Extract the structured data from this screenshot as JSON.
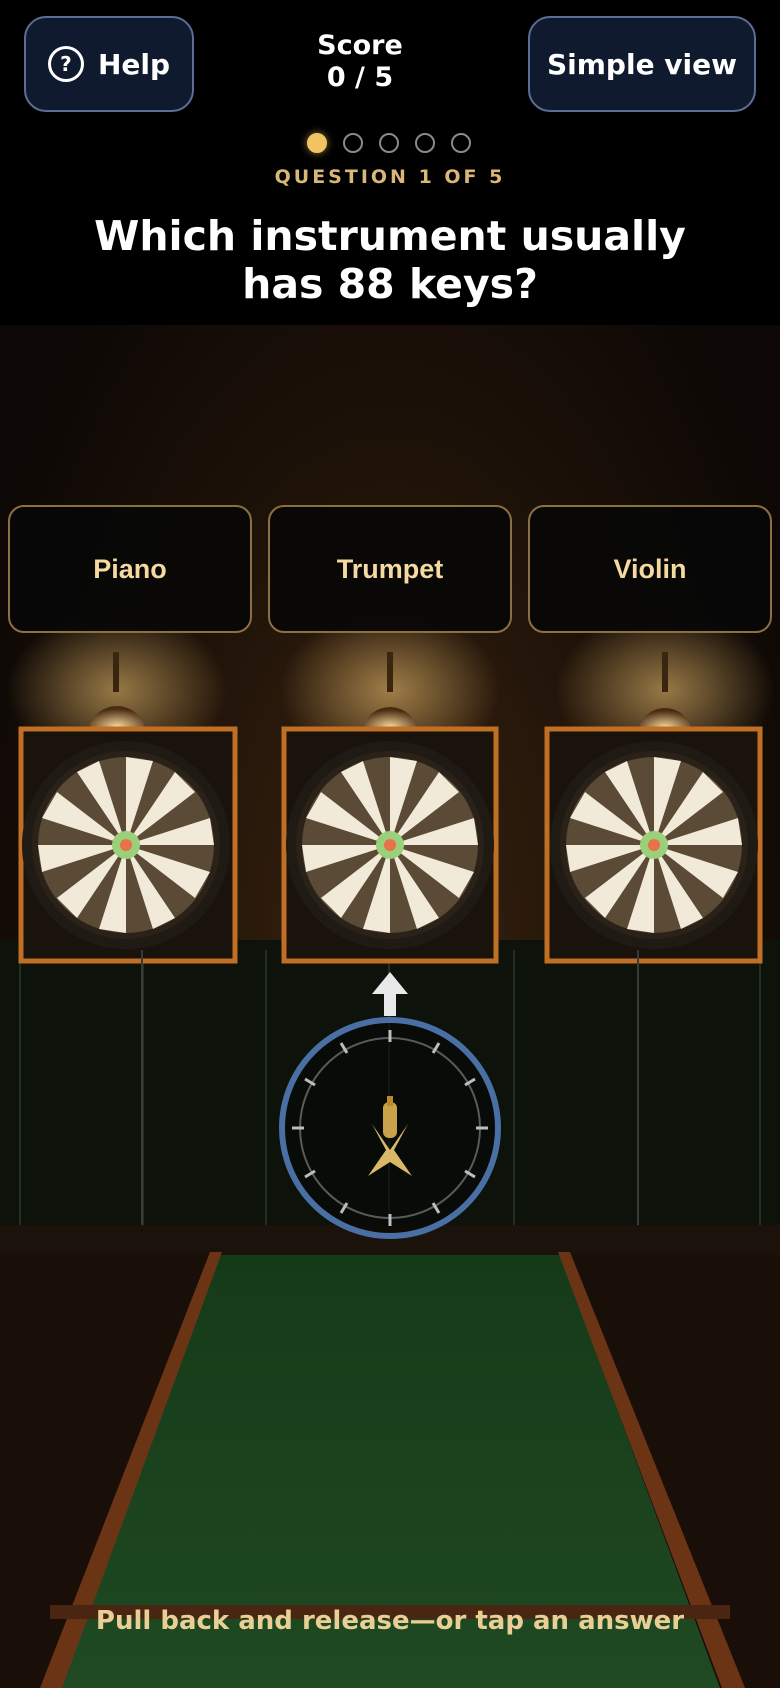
{
  "header": {
    "help_label": "Help",
    "help_glyph": "?",
    "simple_view_label": "Simple view",
    "score_label": "Score",
    "score_value": "0 / 5"
  },
  "progress": {
    "current": 1,
    "total": 5
  },
  "question": {
    "counter": "QUESTION 1 OF 5",
    "text": "Which instrument usually has 88 keys?"
  },
  "answers": [
    {
      "label": "Piano"
    },
    {
      "label": "Trumpet"
    },
    {
      "label": "Violin"
    }
  ],
  "aim": {
    "arrow_icon": "up-arrow-icon",
    "dart_icon": "dart-icon"
  },
  "hint": "Pull back and release—or tap an answer",
  "colors": {
    "accent_gold": "#f0c463",
    "button_bg": "#0f1a2e",
    "button_border": "#5b6f94",
    "lane_green": "#1f4a22",
    "aim_ring": "#4a6fa5"
  }
}
